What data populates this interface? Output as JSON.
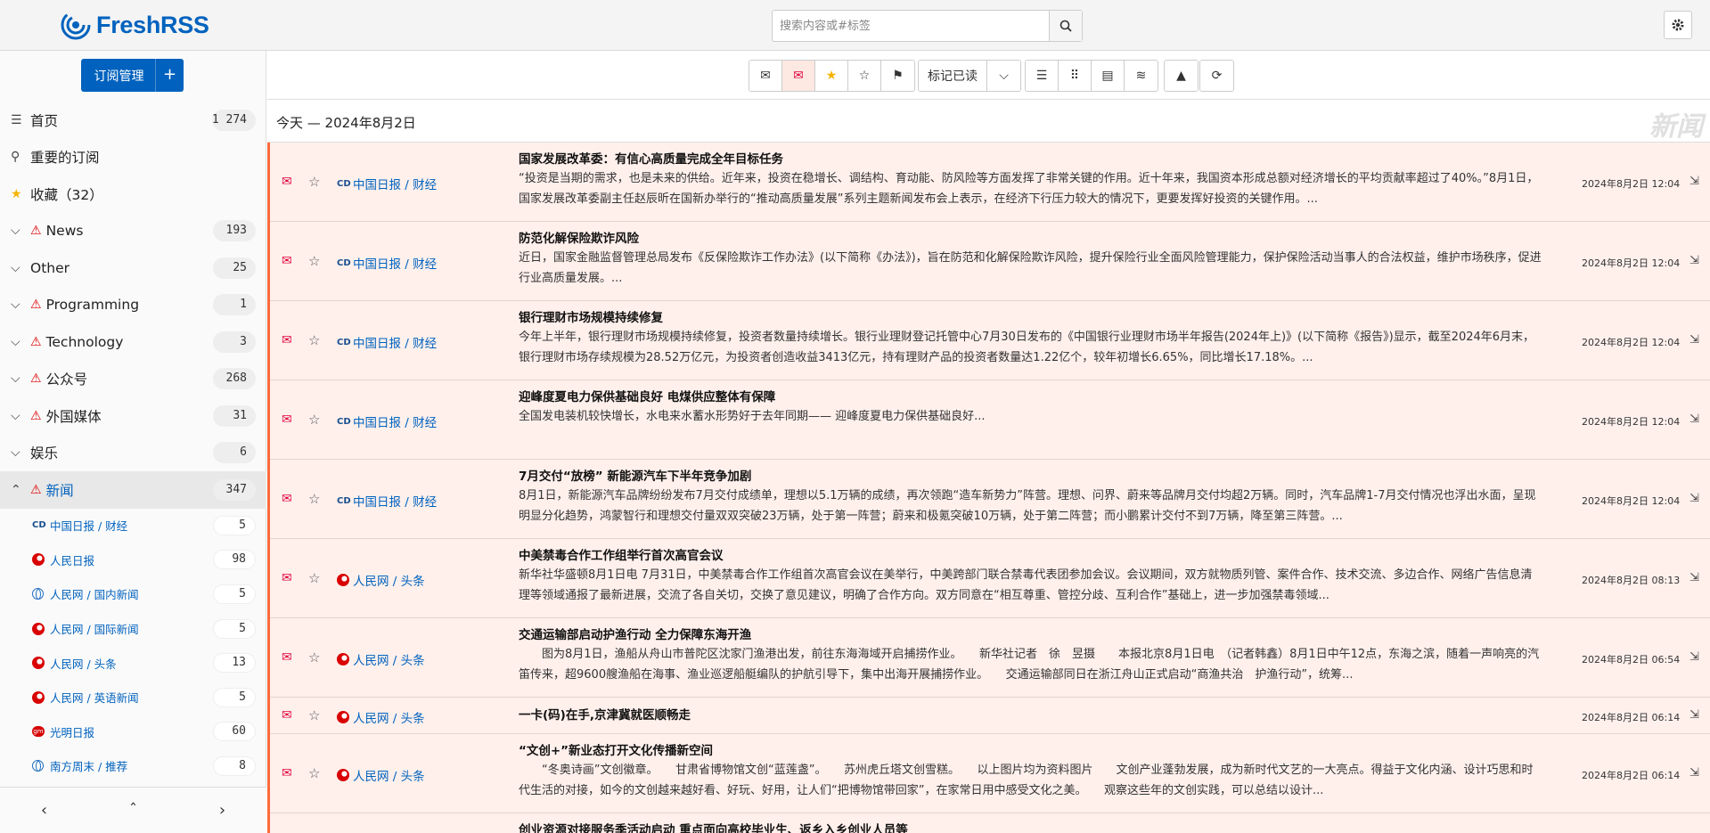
{
  "header": {
    "logo_text": "FreshRSS",
    "search_placeholder": "搜索内容或#标签",
    "brand_color": "#0062be"
  },
  "sidebar": {
    "subscribe_label": "订阅管理",
    "nav": [
      {
        "icon": "list-icon",
        "label": "首页",
        "count": "1 274"
      },
      {
        "icon": "pin-icon",
        "label": "重要的订阅",
        "count": ""
      },
      {
        "icon": "star-icon",
        "label": "收藏（32）",
        "count": ""
      },
      {
        "icon": "chevron-down-icon",
        "warn": true,
        "label": "News",
        "count": "193"
      },
      {
        "icon": "chevron-down-icon",
        "warn": false,
        "label": "Other",
        "count": "25"
      },
      {
        "icon": "chevron-down-icon",
        "warn": true,
        "label": "Programming",
        "count": "1"
      },
      {
        "icon": "chevron-down-icon",
        "warn": true,
        "label": "Technology",
        "count": "3"
      },
      {
        "icon": "chevron-down-icon",
        "warn": true,
        "label": "公众号",
        "count": "268"
      },
      {
        "icon": "chevron-down-icon",
        "warn": true,
        "label": "外国媒体",
        "count": "31"
      },
      {
        "icon": "chevron-down-icon",
        "warn": false,
        "label": "娱乐",
        "count": "6"
      },
      {
        "icon": "chevron-up-icon",
        "warn": true,
        "label": "新闻",
        "count": "347",
        "active": true
      }
    ],
    "feeds": [
      {
        "icon": "cd-icon",
        "label": "中国日报 / 财经",
        "count": "5"
      },
      {
        "icon": "rm-icon",
        "label": "人民日报",
        "count": "98"
      },
      {
        "icon": "globe-icon",
        "label": "人民网 / 国内新闻",
        "count": "5"
      },
      {
        "icon": "rm-icon",
        "label": "人民网 / 国际新闻",
        "count": "5"
      },
      {
        "icon": "rm-icon",
        "label": "人民网 / 头条",
        "count": "13"
      },
      {
        "icon": "rm-icon",
        "label": "人民网 / 英语新闻",
        "count": "5"
      },
      {
        "icon": "gm-icon",
        "label": "光明日报",
        "count": "60"
      },
      {
        "icon": "globe-icon",
        "label": "南方周末 / 推荐",
        "count": "8"
      }
    ]
  },
  "toolbar": {
    "mark_read_label": "标记已读",
    "accent_color": "#ff6a3c"
  },
  "day_heading": {
    "text": "今天 — 2024年8月2日",
    "watermark": "新闻"
  },
  "articles": [
    {
      "feed": "中国日报 / 财经",
      "feed_icon": "cd-icon",
      "title": "国家发展改革委：有信心高质量完成全年目标任务",
      "summary": "“投资是当期的需求，也是未来的供给。近年来，投资在稳增长、调结构、育动能、防风险等方面发挥了非常关键的作用。近十年来，我国资本形成总额对经济增长的平均贡献率超过了40%。”8月1日，国家发展改革委副主任赵辰昕在国新办举行的“推动高质量发展”系列主题新闻发布会上表示，在经济下行压力较大的情况下，更要发挥好投资的关键作用。...",
      "date": "2024年8月2日 12:04"
    },
    {
      "feed": "中国日报 / 财经",
      "feed_icon": "cd-icon",
      "title": "防范化解保险欺诈风险",
      "summary": "近日，国家金融监督管理总局发布《反保险欺诈工作办法》(以下简称《办法》)，旨在防范和化解保险欺诈风险，提升保险行业全面风险管理能力，保护保险活动当事人的合法权益，维护市场秩序，促进行业高质量发展。...",
      "date": "2024年8月2日 12:04"
    },
    {
      "feed": "中国日报 / 财经",
      "feed_icon": "cd-icon",
      "title": "银行理财市场规模持续修复",
      "summary": "今年上半年，银行理财市场规模持续修复，投资者数量持续增长。银行业理财登记托管中心7月30日发布的《中国银行业理财市场半年报告(2024年上)》(以下简称《报告》)显示，截至2024年6月末，银行理财市场存续规模为28.52万亿元，为投资者创造收益3413亿元，持有理财产品的投资者数量达1.22亿个，较年初增长6.65%，同比增长17.18%。...",
      "date": "2024年8月2日 12:04"
    },
    {
      "feed": "中国日报 / 财经",
      "feed_icon": "cd-icon",
      "title": "迎峰度夏电力保供基础良好 电煤供应整体有保障",
      "summary": "全国发电装机较快增长，水电来水蓄水形势好于去年同期—— 迎峰度夏电力保供基础良好...",
      "date": "2024年8月2日 12:04"
    },
    {
      "feed": "中国日报 / 财经",
      "feed_icon": "cd-icon",
      "title": "7月交付“放榜” 新能源汽车下半年竞争加剧",
      "summary": "8月1日，新能源汽车品牌纷纷发布7月交付成绩单，理想以5.1万辆的成绩，再次领跑“造车新势力”阵营。理想、问界、蔚来等品牌月交付均超2万辆。同时，汽车品牌1-7月交付情况也浮出水面，呈现明显分化趋势，鸿蒙智行和理想交付量双双突破23万辆，处于第一阵营；蔚来和极氪突破10万辆，处于第二阵营；而小鹏累计交付不到7万辆，降至第三阵营。...",
      "date": "2024年8月2日 12:04"
    },
    {
      "feed": "人民网 / 头条",
      "feed_icon": "rm-icon",
      "title": "中美禁毒合作工作组举行首次高官会议",
      "summary": "新华社华盛顿8月1日电 7月31日，中美禁毒合作工作组首次高官会议在美举行，中美跨部门联合禁毒代表团参加会议。会议期间，双方就物质列管、案件合作、技术交流、多边合作、网络广告信息清理等领域通报了最新进展，交流了各自关切，交换了意见建议，明确了合作方向。双方同意在“相互尊重、管控分歧、互利合作”基础上，进一步加强禁毒领域...",
      "date": "2024年8月2日 08:13"
    },
    {
      "feed": "人民网 / 头条",
      "feed_icon": "rm-icon",
      "title": "交通运输部启动护渔行动 全力保障东海开渔",
      "summary": "　　图为8月1日，渔船从舟山市普陀区沈家门渔港出发，前往东海海域开启捕捞作业。　　新华社记者　徐　昱摄　　本报北京8月1日电　（记者韩鑫）8月1日中午12点，东海之滨，随着一声响亮的汽笛传来，超9600艘渔船在海事、渔业巡逻船艇编队的护航引导下，集中出海开展捕捞作业。　　交通运输部同日在浙江舟山正式启动“商渔共治　护渔行动”，统筹...",
      "date": "2024年8月2日 06:54"
    },
    {
      "feed": "人民网 / 头条",
      "feed_icon": "rm-icon",
      "title": "一卡(码)在手,京津冀就医顺畅走",
      "summary": "",
      "date": "2024年8月2日 06:14"
    },
    {
      "feed": "人民网 / 头条",
      "feed_icon": "rm-icon",
      "title": "“文创+”新业态打开文化传播新空间",
      "summary": "　　“冬奥诗画”文创徽章。　　甘肃省博物馆文创“蓝莲盏”。　　苏州虎丘塔文创雪糕。　　以上图片均为资料图片　　文创产业蓬勃发展，成为新时代文艺的一大亮点。得益于文化内涵、设计巧思和时代生活的对接，如今的文创越来越好看、好玩、好用，让人们“把博物馆带回家”，在家常日用中感受文化之美。　　观察这些年的文创实践，可以总结以设计...",
      "date": "2024年8月2日 06:14"
    },
    {
      "feed": "",
      "feed_icon": "",
      "title": "创业资源对接服务季活动启动 重点面向高校毕业生、返乡入乡创业人员等",
      "summary": "",
      "date": ""
    }
  ]
}
